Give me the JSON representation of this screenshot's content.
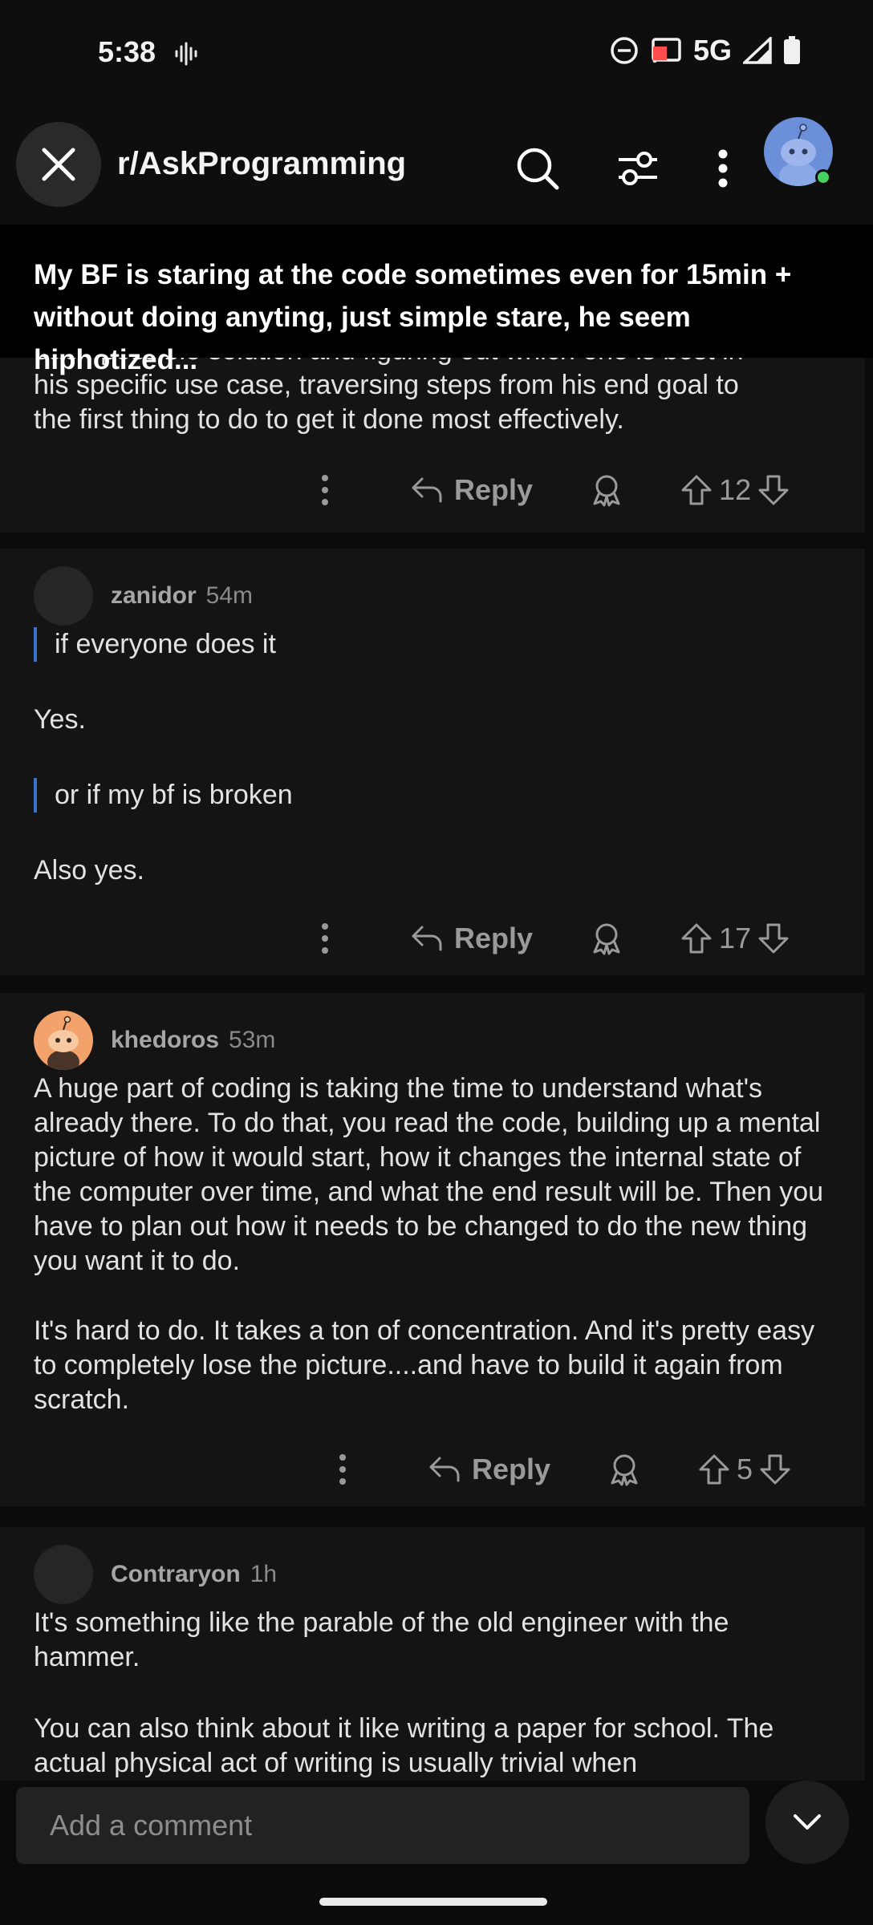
{
  "status_bar": {
    "time": "5:38",
    "network": "5G"
  },
  "header": {
    "subreddit": "r/AskProgramming"
  },
  "post": {
    "title": "My BF is staring at the code sometimes even for 15min + without doing anyting, just simple stare, he seem hiphotized..."
  },
  "comments": [
    {
      "body_lines": [
        "each possible solution and figuring out which one is best in",
        "his specific use case, traversing steps from his end goal to",
        "the first thing to do to get it done most effectively."
      ],
      "reply_label": "Reply",
      "score": "12"
    },
    {
      "author": "zanidor",
      "age": "54m",
      "quote1": "if everyone does it",
      "para1": "Yes.",
      "quote2": "or if my bf is broken",
      "para2": "Also yes.",
      "reply_label": "Reply",
      "score": "17"
    },
    {
      "author": "khedoros",
      "age": "53m",
      "para1": "A huge part of coding is taking the time to understand what's already there. To do that, you read the code, building up a mental picture of how it would start, how it changes the internal state of the computer over time, and what the end result will be. Then you have to plan out how it needs to be changed to do the new thing you want it to do.",
      "para2": "It's hard to do. It takes a ton of concentration. And it's pretty easy to completely lose the picture....and have to build it again from scratch.",
      "reply_label": "Reply",
      "score": "5"
    },
    {
      "author": "Contraryon",
      "age": "1h",
      "para1": "It's something like the parable of the old engineer with the hammer.",
      "para2": "You can also think about it like writing a paper for school. The actual physical act of writing is usually trivial when"
    }
  ],
  "composer": {
    "placeholder": "Add a comment"
  },
  "colors": {
    "background": "#0b0b0b",
    "card": "#141414",
    "quote_bar": "#3a73c9",
    "online": "#46d160",
    "avatar_blue": "#6b8fd9",
    "avatar_orange": "#f2a26a"
  },
  "icons": [
    "close-icon",
    "search-icon",
    "filter-icon",
    "more-vertical-icon",
    "reply-icon",
    "award-icon",
    "upvote-icon",
    "downvote-icon",
    "chevron-down-icon"
  ]
}
